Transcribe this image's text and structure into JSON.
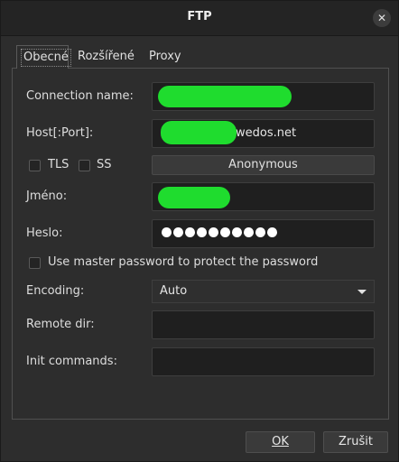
{
  "window": {
    "title": "FTP",
    "close_glyph": "✕"
  },
  "tabs": [
    {
      "label": "Obecné",
      "active": true
    },
    {
      "label": "Rozšířené",
      "active": false
    },
    {
      "label": "Proxy",
      "active": false
    }
  ],
  "form": {
    "connection_name_label": "Connection name:",
    "host_label": "Host[:Port]:",
    "host_value_suffix": "wedos.net",
    "tls_label": "TLS",
    "ss_label": "SS",
    "anonymous_label": "Anonymous",
    "jmeno_label": "Jméno:",
    "heslo_label": "Heslo:",
    "master_password_label": "Use master password to protect the password",
    "encoding_label": "Encoding:",
    "encoding_value": "Auto",
    "remote_dir_label": "Remote dir:",
    "remote_dir_value": "",
    "init_commands_label": "Init commands:",
    "init_commands_value": ""
  },
  "buttons": {
    "ok_label": "OK",
    "cancel_label": "Zrušit"
  },
  "colors": {
    "redaction": "#1fdc2e",
    "background": "#2d2d2d"
  }
}
